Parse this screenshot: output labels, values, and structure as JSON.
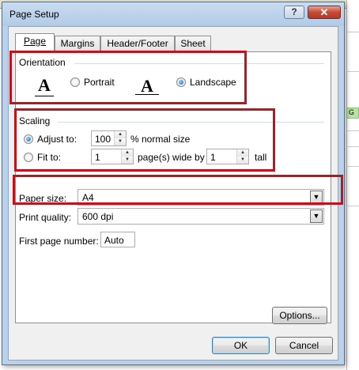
{
  "dialog": {
    "title": "Page Setup",
    "help_glyph": "?",
    "close_glyph": "✕"
  },
  "tabs": [
    {
      "label": "Page",
      "active": true
    },
    {
      "label": "Margins",
      "active": false
    },
    {
      "label": "Header/Footer",
      "active": false
    },
    {
      "label": "Sheet",
      "active": false
    }
  ],
  "orientation": {
    "group_label": "Orientation",
    "portrait_icon": "A",
    "portrait_label": "Portrait",
    "landscape_icon": "A",
    "landscape_label": "Landscape",
    "selected": "landscape"
  },
  "scaling": {
    "group_label": "Scaling",
    "adjust_label": "Adjust to:",
    "adjust_value": "100",
    "adjust_suffix": "% normal size",
    "fit_label": "Fit to:",
    "fit_wide_value": "1",
    "fit_wide_suffix": "page(s) wide by",
    "fit_tall_value": "1",
    "fit_tall_suffix": "tall",
    "selected": "adjust"
  },
  "paper_size": {
    "label": "Paper size:",
    "value": "A4"
  },
  "print_quality": {
    "label": "Print quality:",
    "value": "600 dpi"
  },
  "first_page_number": {
    "label": "First page number:",
    "value": "Auto"
  },
  "buttons": {
    "options": "Options...",
    "ok": "OK",
    "cancel": "Cancel"
  },
  "background": {
    "cell_text": "G"
  },
  "colors": {
    "highlight": "#c0141c",
    "titlebar": "#b9d1ea",
    "close_button": "#c54a35"
  }
}
